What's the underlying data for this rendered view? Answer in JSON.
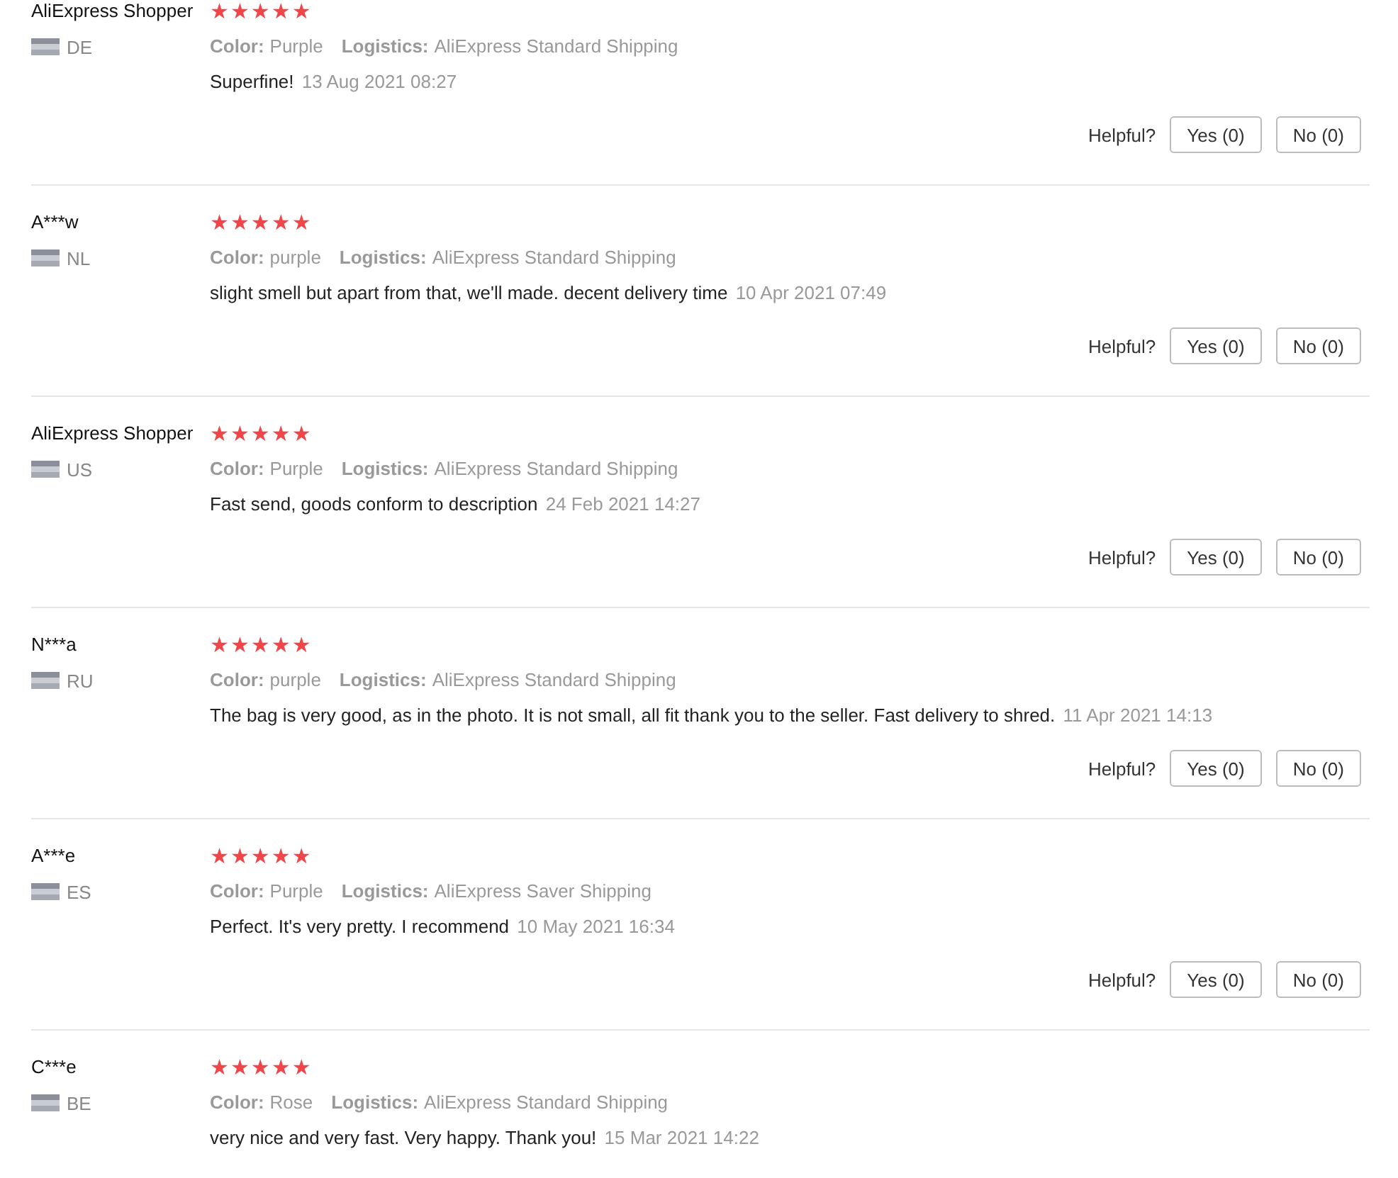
{
  "reviews": [
    {
      "name": "AliExpress Shopper",
      "country": "DE",
      "stars": 5,
      "color_label": "Color:",
      "color_value": "Purple",
      "logistics_label": "Logistics:",
      "logistics_value": "AliExpress Standard Shipping",
      "text": "Superfine!",
      "date": "13 Aug 2021 08:27",
      "helpful": "Helpful?",
      "yes": "Yes (0)",
      "no": "No (0)"
    },
    {
      "name": "A***w",
      "country": "NL",
      "stars": 5,
      "color_label": "Color:",
      "color_value": "purple",
      "logistics_label": "Logistics:",
      "logistics_value": "AliExpress Standard Shipping",
      "text": "slight smell but apart from that, we'll made. decent delivery time",
      "date": "10 Apr 2021 07:49",
      "helpful": "Helpful?",
      "yes": "Yes (0)",
      "no": "No (0)"
    },
    {
      "name": "AliExpress Shopper",
      "country": "US",
      "stars": 5,
      "color_label": "Color:",
      "color_value": "Purple",
      "logistics_label": "Logistics:",
      "logistics_value": "AliExpress Standard Shipping",
      "text": "Fast send, goods conform to description",
      "date": "24 Feb 2021 14:27",
      "helpful": "Helpful?",
      "yes": "Yes (0)",
      "no": "No (0)"
    },
    {
      "name": "N***a",
      "country": "RU",
      "stars": 5,
      "color_label": "Color:",
      "color_value": "purple",
      "logistics_label": "Logistics:",
      "logistics_value": "AliExpress Standard Shipping",
      "text": "The bag is very good, as in the photo. It is not small, all fit thank you to the seller. Fast delivery to shred.",
      "date": "11 Apr 2021 14:13",
      "helpful": "Helpful?",
      "yes": "Yes (0)",
      "no": "No (0)"
    },
    {
      "name": "A***e",
      "country": "ES",
      "stars": 5,
      "color_label": "Color:",
      "color_value": "Purple",
      "logistics_label": "Logistics:",
      "logistics_value": "AliExpress Saver Shipping",
      "text": "Perfect. It's very pretty. I recommend",
      "date": "10 May 2021 16:34",
      "helpful": "Helpful?",
      "yes": "Yes (0)",
      "no": "No (0)"
    },
    {
      "name": "C***e",
      "country": "BE",
      "stars": 5,
      "color_label": "Color:",
      "color_value": "Rose",
      "logistics_label": "Logistics:",
      "logistics_value": "AliExpress Standard Shipping",
      "text": "very nice and very fast. Very happy. Thank you!",
      "date": "15 Mar 2021 14:22"
    }
  ]
}
